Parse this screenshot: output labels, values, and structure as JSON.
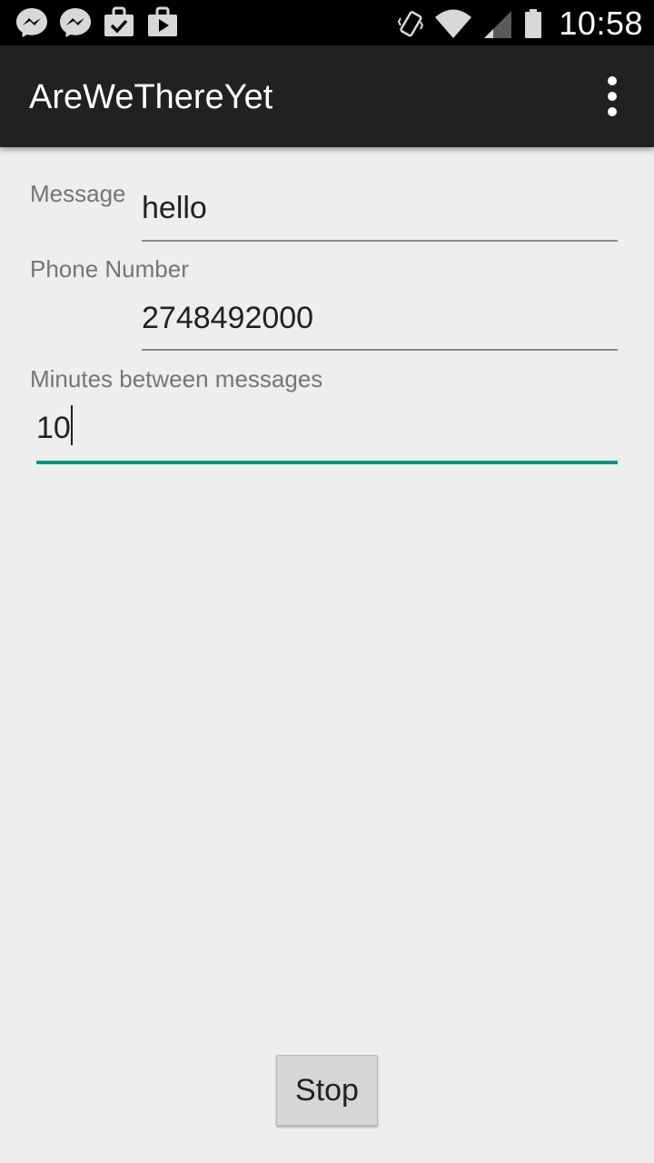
{
  "status_bar": {
    "time": "10:58",
    "left_icons": [
      "messenger-icon",
      "messenger-icon",
      "shopping-bag-check-icon",
      "shopping-bag-play-icon"
    ],
    "right_icons": [
      "vibrate-icon",
      "wifi-icon",
      "signal-icon",
      "battery-icon"
    ]
  },
  "action_bar": {
    "title": "AreWeThereYet",
    "menu_icon": "overflow-menu-icon"
  },
  "form": {
    "message": {
      "label": "Message",
      "value": "hello"
    },
    "phone": {
      "label": "Phone Number",
      "value": "2748492000"
    },
    "minutes": {
      "label": "Minutes between messages",
      "value": "10"
    }
  },
  "stop_button": {
    "label": "Stop"
  },
  "colors": {
    "accent": "#009688",
    "action_bar": "#212121",
    "background": "#eeeeee"
  }
}
